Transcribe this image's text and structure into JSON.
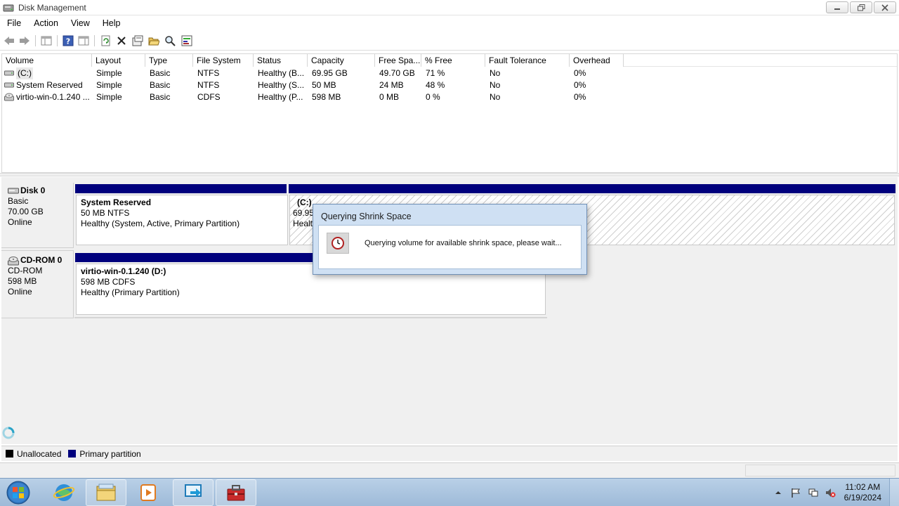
{
  "window": {
    "title": "Disk Management"
  },
  "menu": {
    "items": [
      "File",
      "Action",
      "View",
      "Help"
    ]
  },
  "volume_list": {
    "columns": [
      "Volume",
      "Layout",
      "Type",
      "File System",
      "Status",
      "Capacity",
      "Free Spa...",
      "% Free",
      "Fault Tolerance",
      "Overhead"
    ],
    "rows": [
      {
        "volume": "(C:)",
        "layout": "Simple",
        "type": "Basic",
        "fs": "NTFS",
        "status": "Healthy (B...",
        "capacity": "69.95 GB",
        "free": "49.70 GB",
        "pct": "71 %",
        "fault": "No",
        "overhead": "0%"
      },
      {
        "volume": "System Reserved",
        "layout": "Simple",
        "type": "Basic",
        "fs": "NTFS",
        "status": "Healthy (S...",
        "capacity": "50 MB",
        "free": "24 MB",
        "pct": "48 %",
        "fault": "No",
        "overhead": "0%"
      },
      {
        "volume": "virtio-win-0.1.240 ...",
        "layout": "Simple",
        "type": "Basic",
        "fs": "CDFS",
        "status": "Healthy (P...",
        "capacity": "598 MB",
        "free": "0 MB",
        "pct": "0 %",
        "fault": "No",
        "overhead": "0%"
      }
    ]
  },
  "disks": [
    {
      "name": "Disk 0",
      "kind": "Basic",
      "size": "70.00 GB",
      "state": "Online",
      "partitions": [
        {
          "name": "System Reserved",
          "detail": "50 MB NTFS",
          "status": "Healthy (System, Active, Primary Partition)"
        },
        {
          "name": "(C:)",
          "detail": "69.95",
          "status": "Healt"
        }
      ]
    },
    {
      "name": "CD-ROM 0",
      "kind": "CD-ROM",
      "size": "598 MB",
      "state": "Online",
      "partitions": [
        {
          "name": "virtio-win-0.1.240  (D:)",
          "detail": "598 MB CDFS",
          "status": "Healthy (Primary Partition)"
        }
      ]
    }
  ],
  "legend": [
    {
      "label": "Unallocated",
      "color": "#000000"
    },
    {
      "label": "Primary partition",
      "color": "#00007d"
    }
  ],
  "dialog": {
    "title": "Querying Shrink Space",
    "message": "Querying volume for available shrink space, please wait..."
  },
  "taskbar": {
    "time": "11:02 AM",
    "date": "6/19/2024"
  },
  "colors": {
    "primary_partition": "#00007d",
    "dialog_frame": "#cfe0f3",
    "taskbar": "#b9d0e7"
  }
}
